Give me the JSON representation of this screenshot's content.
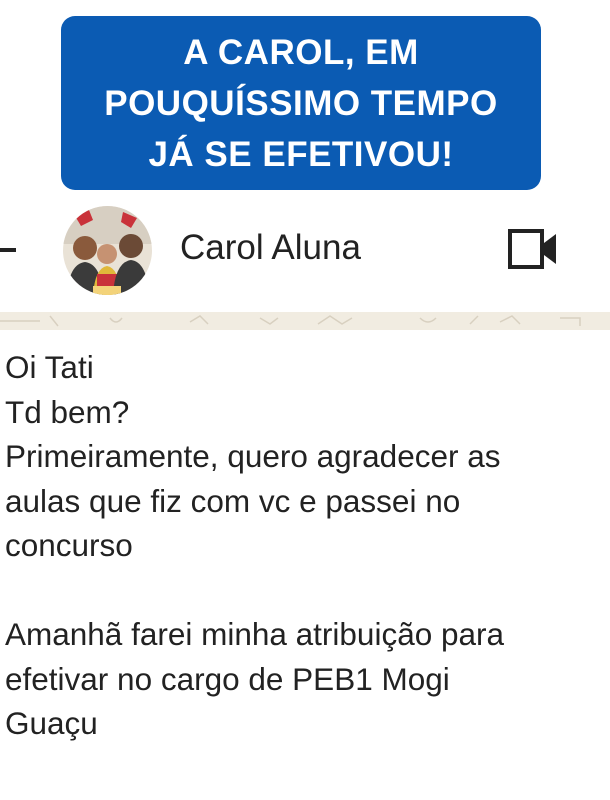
{
  "banner": {
    "lines": [
      "A CAROL, EM",
      "POUQUÍSSIMO TEMPO",
      "JÁ SE EFETIVOU!"
    ],
    "background_color": "#0b5bb3"
  },
  "header": {
    "back_icon": "back-arrow-icon",
    "contact_name": "Carol Aluna",
    "video_icon": "video-camera-icon"
  },
  "message": {
    "lines": [
      "Oi Tati",
      "Td bem?",
      "Primeiramente, quero agradecer as",
      "aulas que fiz com vc e passei no",
      "concurso",
      "",
      "Amanhã farei minha atribuição para",
      "efetivar no cargo de PEB1 Mogi",
      "Guaçu"
    ]
  }
}
